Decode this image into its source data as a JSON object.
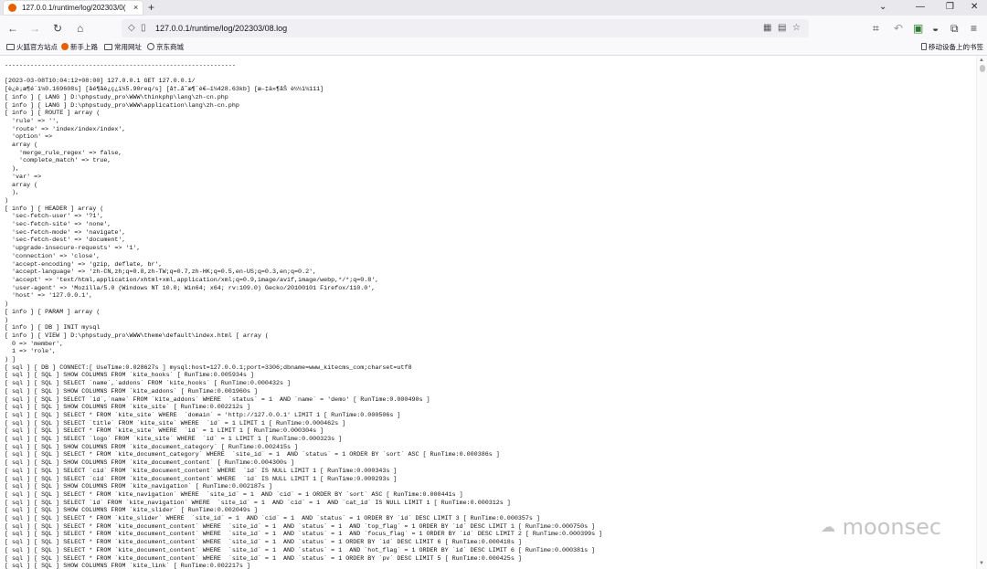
{
  "browser": {
    "tab_title": "127.0.0.1/runtime/log/202303/0(",
    "tab_close": "×",
    "new_tab": "+",
    "url": "127.0.0.1/runtime/log/202303/08.log",
    "window_controls": [
      "⌄",
      "—",
      "❐",
      "✕"
    ],
    "nav_icons": [
      "back-icon",
      "forward-icon",
      "reload-icon",
      "home-icon"
    ],
    "bookmarks": [
      {
        "label": "火狐官方站点",
        "icon": "folder-icon"
      },
      {
        "label": "新手上路",
        "icon": "firefox-icon"
      },
      {
        "label": "常用网址",
        "icon": "folder-icon"
      },
      {
        "label": "京东商城",
        "icon": "globe-icon"
      }
    ],
    "mobile_bookmarks": "移动设备上的书签"
  },
  "log_lines": [
    "---------------------------------------------------------------",
    "",
    "[2023-03-08T10:04:12+08:00] 127.0.0.1 GET 127.0.0.1/",
    "[è¿è¡æ¶é´ï¼0.169608s] [åé¶åè¿ç¿ï¼5.90req/s] [å†…å­˜æ¶ˆè€—ï¼428.63kb] [æ–‡ä»¶åŠ è½½ï¼111]",
    "[ info ] [ LANG ] D:\\phpstudy_pro\\WWW\\thinkphp\\lang\\zh-cn.php",
    "[ info ] [ LANG ] D:\\phpstudy_pro\\WWW\\application\\lang\\zh-cn.php",
    "[ info ] [ ROUTE ] array (",
    "  'rule' => '',",
    "  'route' => 'index/index/index',",
    "  'option' =>",
    "  array (",
    "    'merge_rule_regex' => false,",
    "    'complete_match' => true,",
    "  ),",
    "  'var' =>",
    "  array (",
    "  ),",
    ")",
    "[ info ] [ HEADER ] array (",
    "  'sec-fetch-user' => '?1',",
    "  'sec-fetch-site' => 'none',",
    "  'sec-fetch-mode' => 'navigate',",
    "  'sec-fetch-dest' => 'document',",
    "  'upgrade-insecure-requests' => '1',",
    "  'connection' => 'close',",
    "  'accept-encoding' => 'gzip, deflate, br',",
    "  'accept-language' => 'zh-CN,zh;q=0.8,zh-TW;q=0.7,zh-HK;q=0.5,en-US;q=0.3,en;q=0.2',",
    "  'accept' => 'text/html,application/xhtml+xml,application/xml;q=0.9,image/avif,image/webp,*/*;q=0.8',",
    "  'user-agent' => 'Mozilla/5.0 (Windows NT 10.0; Win64; x64; rv:109.0) Gecko/20100101 Firefox/110.0',",
    "  'host' => '127.0.0.1',",
    ")",
    "[ info ] [ PARAM ] array (",
    ")",
    "[ info ] [ DB ] INIT mysql",
    "[ info ] [ VIEW ] D:\\phpstudy_pro\\WWW\\theme\\default\\index.html [ array (",
    "  0 => 'member',",
    "  1 => 'role',",
    ") ]",
    "[ sql ] [ DB ] CONNECT:[ UseTime:0.028627s ] mysql:host=127.0.0.1;port=3306;dbname=www_kitecms_com;charset=utf8",
    "[ sql ] [ SQL ] SHOW COLUMNS FROM `kite_hooks` [ RunTime:0.005934s ]",
    "[ sql ] [ SQL ] SELECT `name`,`addons` FROM `kite_hooks` [ RunTime:0.000432s ]",
    "[ sql ] [ SQL ] SHOW COLUMNS FROM `kite_addons` [ RunTime:0.001960s ]",
    "[ sql ] [ SQL ] SELECT `id`,`name` FROM `kite_addons` WHERE  `status` = 1  AND `name` = 'demo' [ RunTime:0.000490s ]",
    "[ sql ] [ SQL ] SHOW COLUMNS FROM `kite_site` [ RunTime:0.002212s ]",
    "[ sql ] [ SQL ] SELECT * FROM `kite_site` WHERE  `domain` = 'http://127.0.0.1' LIMIT 1 [ RunTime:0.000506s ]",
    "[ sql ] [ SQL ] SELECT `title` FROM `kite_site` WHERE  `id` = 1 LIMIT 1 [ RunTime:0.000462s ]",
    "[ sql ] [ SQL ] SELECT * FROM `kite_site` WHERE  `id` = 1 LIMIT 1 [ RunTime:0.000304s ]",
    "[ sql ] [ SQL ] SELECT `logo` FROM `kite_site` WHERE  `id` = 1 LIMIT 1 [ RunTime:0.000323s ]",
    "[ sql ] [ SQL ] SHOW COLUMNS FROM `kite_document_category` [ RunTime:0.002415s ]",
    "[ sql ] [ SQL ] SELECT * FROM `kite_document_category` WHERE  `site_id` = 1  AND `status` = 1 ORDER BY `sort` ASC [ RunTime:0.000386s ]",
    "[ sql ] [ SQL ] SHOW COLUMNS FROM `kite_document_content` [ RunTime:0.004300s ]",
    "[ sql ] [ SQL ] SELECT `cid` FROM `kite_document_content` WHERE  `id` IS NULL LIMIT 1 [ RunTime:0.000343s ]",
    "[ sql ] [ SQL ] SELECT `cid` FROM `kite_document_content` WHERE  `id` IS NULL LIMIT 1 [ RunTime:0.000293s ]",
    "[ sql ] [ SQL ] SHOW COLUMNS FROM `kite_navigation` [ RunTime:0.002187s ]",
    "[ sql ] [ SQL ] SELECT * FROM `kite_navigation` WHERE  `site_id` = 1  AND `cid` = 1 ORDER BY `sort` ASC [ RunTime:0.000441s ]",
    "[ sql ] [ SQL ] SELECT `id` FROM `kite_navigation` WHERE  `site_id` = 1  AND `cid` = 1  AND `cat_id` IS NULL LIMIT 1 [ RunTime:0.000312s ]",
    "[ sql ] [ SQL ] SHOW COLUMNS FROM `kite_slider` [ RunTime:0.002049s ]",
    "[ sql ] [ SQL ] SELECT * FROM `kite_slider` WHERE  `site_id` = 1  AND `cid` = 1  AND `status` = 1 ORDER BY `id` DESC LIMIT 3 [ RunTime:0.000357s ]",
    "[ sql ] [ SQL ] SELECT * FROM `kite_document_content` WHERE  `site_id` = 1  AND `status` = 1  AND `top_flag` = 1 ORDER BY `id` DESC LIMIT 1 [ RunTime:0.000750s ]",
    "[ sql ] [ SQL ] SELECT * FROM `kite_document_content` WHERE  `site_id` = 1  AND `status` = 1  AND `focus_flag` = 1 ORDER BY `id` DESC LIMIT 2 [ RunTime:0.000399s ]",
    "[ sql ] [ SQL ] SELECT * FROM `kite_document_content` WHERE  `site_id` = 1  AND `status` = 1 ORDER BY `id` DESC LIMIT 6 [ RunTime:0.000418s ]",
    "[ sql ] [ SQL ] SELECT * FROM `kite_document_content` WHERE  `site_id` = 1  AND `status` = 1  AND `hot_flag` = 1 ORDER BY `id` DESC LIMIT 6 [ RunTime:0.000381s ]",
    "[ sql ] [ SQL ] SELECT * FROM `kite_document_content` WHERE  `site_id` = 1  AND `status` = 1 ORDER BY `pv` DESC LIMIT 5 [ RunTime:0.000425s ]",
    "[ sql ] [ SQL ] SHOW COLUMNS FROM `kite_link` [ RunTime:0.002217s ]"
  ],
  "watermark": "moonsec"
}
